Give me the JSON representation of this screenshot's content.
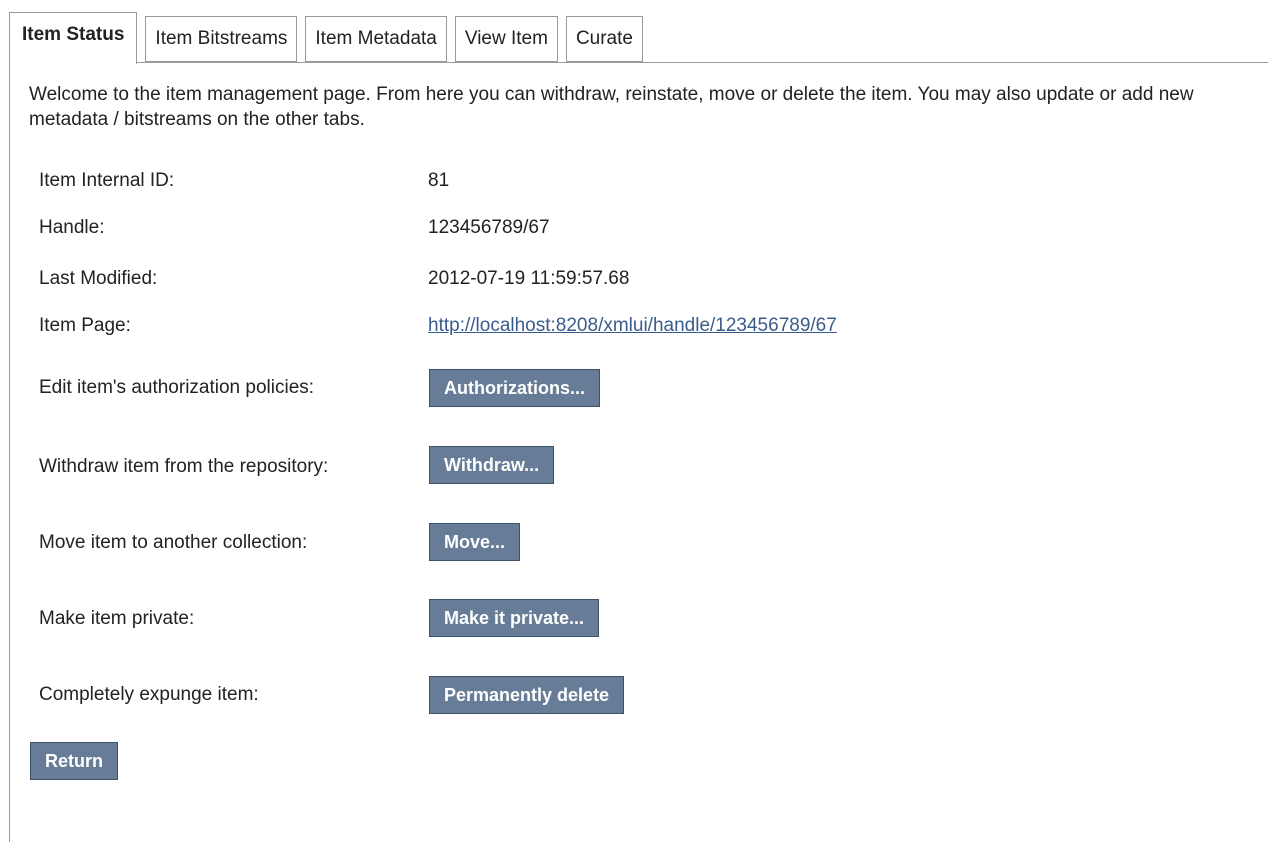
{
  "tabs": [
    {
      "label": "Item Status",
      "active": true
    },
    {
      "label": "Item Bitstreams",
      "active": false
    },
    {
      "label": "Item Metadata",
      "active": false
    },
    {
      "label": "View Item",
      "active": false
    },
    {
      "label": "Curate",
      "active": false
    }
  ],
  "intro": "Welcome to the item management page. From here you can withdraw, reinstate, move or delete the item. You may also update or add new metadata / bitstreams on the other tabs.",
  "fields": {
    "internal_id_label": "Item Internal ID:",
    "internal_id_value": "81",
    "handle_label": "Handle:",
    "handle_value": "123456789/67",
    "last_modified_label": "Last Modified:",
    "last_modified_value": "2012-07-19 11:59:57.68",
    "item_page_label": "Item Page:",
    "item_page_value": "http://localhost:8208/xmlui/handle/123456789/67"
  },
  "actions": {
    "authorizations_label": "Edit item's authorization policies:",
    "authorizations_button": "Authorizations...",
    "withdraw_label": "Withdraw item from the repository:",
    "withdraw_button": "Withdraw...",
    "move_label": "Move item to another collection:",
    "move_button": "Move...",
    "private_label": "Make item private:",
    "private_button": "Make it private...",
    "delete_label": "Completely expunge item:",
    "delete_button": "Permanently delete"
  },
  "return_button": "Return",
  "colors": {
    "button_bg": "#667c97",
    "link": "#3a5c8c",
    "border": "#9a9a9a"
  }
}
